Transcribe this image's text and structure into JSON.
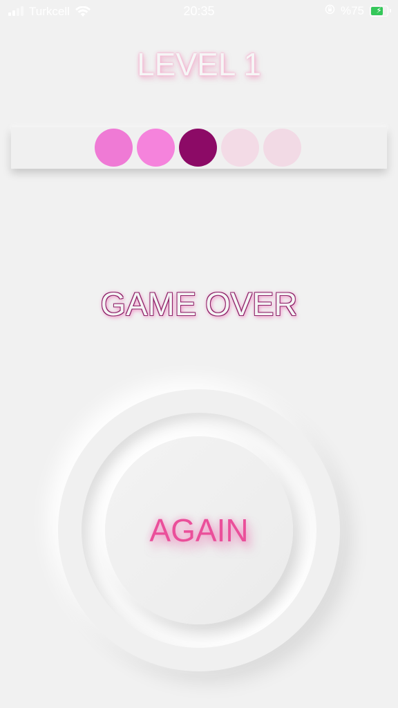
{
  "status_bar": {
    "carrier": "Turkcell",
    "time": "20:35",
    "battery_text": "%75",
    "battery_level": 0.75,
    "icons": [
      "signal-icon",
      "wifi-icon",
      "orientation-lock-icon",
      "battery-icon"
    ]
  },
  "game": {
    "level_title": "LEVEL 1",
    "status_text": "GAME OVER",
    "again_label": "AGAIN",
    "sequence_dots": [
      {
        "color": "#ef7ad5",
        "state": "filled"
      },
      {
        "color": "#f583dc",
        "state": "filled"
      },
      {
        "color": "#8c0a66",
        "state": "current"
      },
      {
        "color": "#f3dbe6",
        "state": "empty"
      },
      {
        "color": "#f2dae5",
        "state": "empty"
      }
    ]
  },
  "colors": {
    "background": "#f1f1f1",
    "accent_pink": "#ea4f9a",
    "dark_magenta": "#8c0a66"
  }
}
